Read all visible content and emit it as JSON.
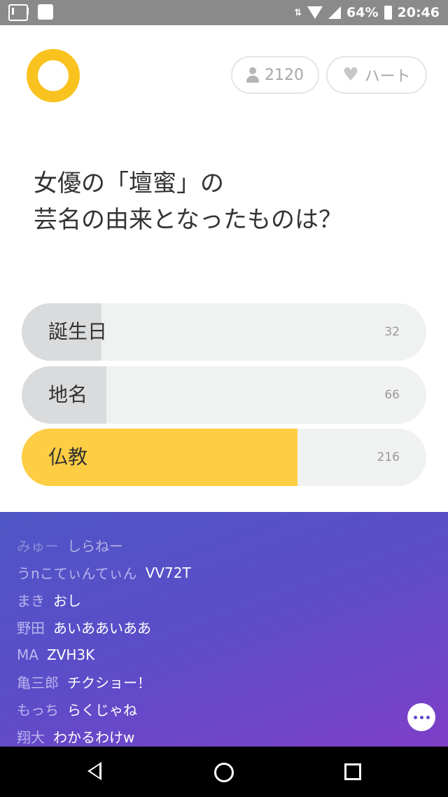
{
  "status_bar": {
    "battery": "64%",
    "time": "20:46"
  },
  "header": {
    "participants": "2120",
    "heart_label": "ハート"
  },
  "question": {
    "line1": "女優の「壇蜜」の",
    "line2": "芸名の由来となったものは？"
  },
  "options": [
    {
      "label": "誕生日",
      "count": "32",
      "fill_fraction": 0.198,
      "selected": false
    },
    {
      "label": "地名",
      "count": "66",
      "fill_fraction": 0.209,
      "selected": false
    },
    {
      "label": "仏教",
      "count": "216",
      "fill_fraction": 0.682,
      "selected": true
    }
  ],
  "chat": [
    {
      "user": "みゅー",
      "message": "しらねー"
    },
    {
      "user": "うnこてぃんてぃん",
      "message": "VV72T"
    },
    {
      "user": "まき",
      "message": "おし"
    },
    {
      "user": "野田",
      "message": "あいああいああ"
    },
    {
      "user": "MA",
      "message": "ZVH3K"
    },
    {
      "user": "亀三郎",
      "message": "チクショー！"
    },
    {
      "user": "もっち",
      "message": "らくじゃね"
    },
    {
      "user": "翔大",
      "message": "わかるわけw"
    }
  ],
  "colors": {
    "accent": "#f9c21f",
    "selected_fill": "#fdcd43",
    "chat_gradient_start": "#4e56c6",
    "chat_gradient_end": "#7e3fc7"
  }
}
